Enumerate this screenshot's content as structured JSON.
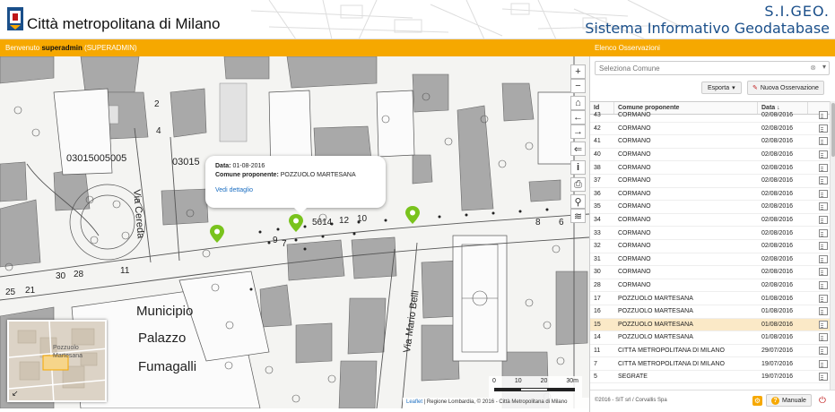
{
  "header": {
    "city_title": "Città metropolitana di Milano",
    "app_short": "S.I.GEO.",
    "app_full": "Sistema Informativo Geodatabase"
  },
  "topbar": {
    "welcome_prefix": "Benvenuto ",
    "username": "superadmin",
    "role": " (SUPERADMIN)",
    "panel_title": "Elenco Osservazioni"
  },
  "popup": {
    "date_label": "Data:",
    "date_value": "01-08-2016",
    "comune_label": "Comune proponente:",
    "comune_value": "POZZUOLO MARTESANA",
    "link": "Vedi dettaglio"
  },
  "map": {
    "controls": [
      "+",
      "−",
      "⌂",
      "←",
      "→",
      "⇐",
      "i",
      "⎙",
      "⚲",
      "≋"
    ],
    "labels": {
      "street1": "Via Cereda",
      "street2": "Via Mario Belli",
      "municipio1": "Municipio",
      "municipio2": "Palazzo",
      "municipio3": "Fumagalli",
      "parcel1": "03015005005",
      "parcel2": "03015",
      "num1": "5614",
      "num2": "12",
      "num3": "10",
      "num4": "8",
      "num5": "6",
      "num6": "25",
      "num7": "21",
      "num8": "30",
      "num9": "28",
      "num10": "11",
      "num11": "9",
      "num12": "7",
      "num13": "2",
      "num14": "4"
    },
    "minimap_label1": "Pozzuolo",
    "minimap_label2": "Martesana",
    "scale_ticks": [
      "0",
      "10",
      "20",
      "30m"
    ],
    "attribution_leaflet": "Leaflet",
    "attribution_rest": " | Regione Lombardia, © 2016 - Città Metropolitana di Milano",
    "colors": {
      "marker": "#79c31d",
      "accent": "#f6a800"
    }
  },
  "panel": {
    "combo_placeholder": "Seleziona Comune",
    "combo_clear": "⊗",
    "combo_caret": "▾",
    "export_label": "Esporta",
    "new_label": "Nuova Osservazione",
    "columns": {
      "id": "Id",
      "comune": "Comune proponente",
      "date": "Data"
    },
    "sort_icon": "↓",
    "rows": [
      {
        "id": "43",
        "comune": "CORMANO",
        "date": "02/08/2016"
      },
      {
        "id": "42",
        "comune": "CORMANO",
        "date": "02/08/2016"
      },
      {
        "id": "41",
        "comune": "CORMANO",
        "date": "02/08/2016"
      },
      {
        "id": "40",
        "comune": "CORMANO",
        "date": "02/08/2016"
      },
      {
        "id": "38",
        "comune": "CORMANO",
        "date": "02/08/2016"
      },
      {
        "id": "37",
        "comune": "CORMANO",
        "date": "02/08/2016"
      },
      {
        "id": "36",
        "comune": "CORMANO",
        "date": "02/08/2016"
      },
      {
        "id": "35",
        "comune": "CORMANO",
        "date": "02/08/2016"
      },
      {
        "id": "34",
        "comune": "CORMANO",
        "date": "02/08/2016"
      },
      {
        "id": "33",
        "comune": "CORMANO",
        "date": "02/08/2016"
      },
      {
        "id": "32",
        "comune": "CORMANO",
        "date": "02/08/2016"
      },
      {
        "id": "31",
        "comune": "CORMANO",
        "date": "02/08/2016"
      },
      {
        "id": "30",
        "comune": "CORMANO",
        "date": "02/08/2016"
      },
      {
        "id": "28",
        "comune": "CORMANO",
        "date": "02/08/2016"
      },
      {
        "id": "17",
        "comune": "POZZUOLO MARTESANA",
        "date": "01/08/2016"
      },
      {
        "id": "16",
        "comune": "POZZUOLO MARTESANA",
        "date": "01/08/2016"
      },
      {
        "id": "15",
        "comune": "POZZUOLO MARTESANA",
        "date": "01/08/2016"
      },
      {
        "id": "14",
        "comune": "POZZUOLO MARTESANA",
        "date": "01/08/2016"
      },
      {
        "id": "11",
        "comune": "CITTÀ METROPOLITANA DI MILANO",
        "date": "29/07/2016"
      },
      {
        "id": "7",
        "comune": "CITTÀ METROPOLITANA DI MILANO",
        "date": "19/07/2016"
      },
      {
        "id": "5",
        "comune": "SEGRATE",
        "date": "19/07/2016"
      }
    ],
    "selected_row_id": "15",
    "copyright": "©2016 - SIT srl / Corvallis Spa",
    "help_label": "Manuale"
  }
}
